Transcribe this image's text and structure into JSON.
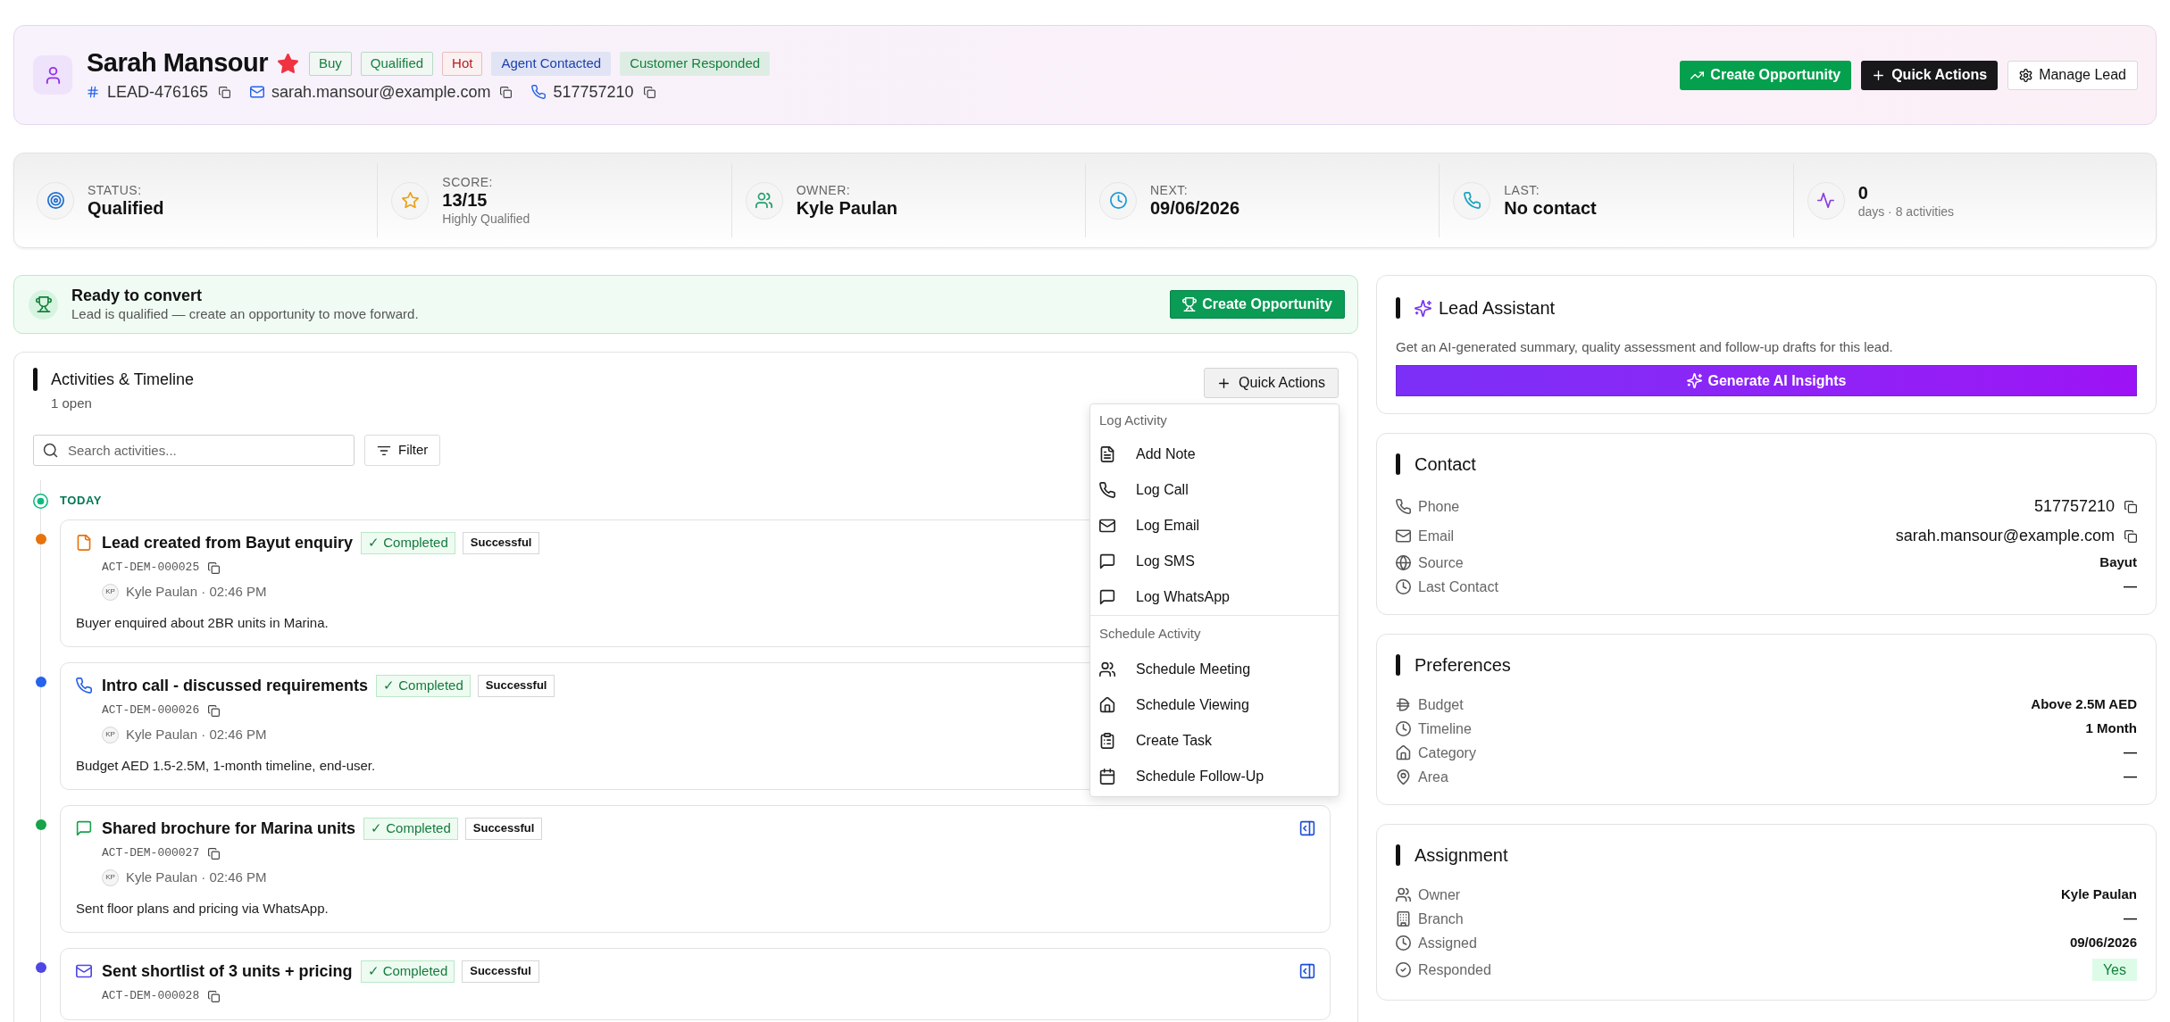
{
  "lead": {
    "name": "Sarah Mansour",
    "starred": true,
    "tags": [
      {
        "label": "Buy",
        "kind": "outline",
        "color": "#15803d"
      },
      {
        "label": "Qualified",
        "kind": "outline",
        "color": "#15803d"
      },
      {
        "label": "Hot",
        "kind": "outline",
        "color": "#b91c1c"
      },
      {
        "label": "Agent Contacted",
        "kind": "filled",
        "color": "#1e40af"
      },
      {
        "label": "Customer Responded",
        "kind": "filled",
        "color": "#15803d"
      }
    ],
    "id": "LEAD-476165",
    "email": "sarah.mansour@example.com",
    "phone": "517757210"
  },
  "header_actions": [
    {
      "label": "Create Opportunity",
      "kind": "create_opportunity"
    },
    {
      "label": "Quick Actions",
      "kind": "quick_actions"
    },
    {
      "label": "Manage Lead",
      "kind": "manage"
    }
  ],
  "stats": [
    {
      "kind": "status",
      "label": "STATUS:",
      "value": "Qualified"
    },
    {
      "kind": "score",
      "label": "SCORE:",
      "value": "13/15",
      "note": "Highly Qualified"
    },
    {
      "kind": "owner",
      "label": "OWNER:",
      "value": "Kyle Paulan"
    },
    {
      "kind": "next",
      "label": "NEXT:",
      "value": "09/06/2026"
    },
    {
      "kind": "last",
      "label": "LAST:",
      "value": "No contact"
    },
    {
      "kind": "activity",
      "value": "0",
      "note": "days · 8 activities"
    }
  ],
  "convert_banner": {
    "title": "Ready to convert",
    "message": "Lead is qualified — create an opportunity to move forward.",
    "button": "Create Opportunity"
  },
  "activities": {
    "title": "Activities & Timeline",
    "subtitle": "1 open",
    "quick_actions": {
      "label": "Quick Actions",
      "expanded": true
    },
    "quick_actions_menu": [
      {
        "heading": "Log Activity",
        "items": [
          {
            "label": "Add Note",
            "kind": "note"
          },
          {
            "label": "Log Call",
            "kind": "call"
          },
          {
            "label": "Log Email",
            "kind": "email"
          },
          {
            "label": "Log SMS",
            "kind": "sms"
          },
          {
            "label": "Log WhatsApp",
            "kind": "whatsapp"
          }
        ]
      },
      {
        "heading": "Schedule Activity",
        "items": [
          {
            "label": "Schedule Meeting",
            "kind": "meeting"
          },
          {
            "label": "Schedule Viewing",
            "kind": "viewing"
          },
          {
            "label": "Create Task",
            "kind": "task"
          },
          {
            "label": "Schedule Follow-Up",
            "kind": "follow_up"
          }
        ]
      }
    ],
    "search": {
      "placeholder": "Search activities..."
    },
    "filter": "Filter",
    "group": "TODAY",
    "items": [
      {
        "kind": "note",
        "color": "#e8720c",
        "title": "Lead created from Bayut enquiry",
        "status": "✓ Completed",
        "outcome": "Successful",
        "ref": "ACT-DEM-000025",
        "initials": "KP",
        "byline": "Kyle Paulan · 02:46 PM",
        "body": "Buyer enquired about 2BR units in Marina."
      },
      {
        "kind": "call",
        "color": "#2563eb",
        "title": "Intro call - discussed requirements",
        "status": "✓ Completed",
        "outcome": "Successful",
        "ref": "ACT-DEM-000026",
        "initials": "KP",
        "byline": "Kyle Paulan · 02:46 PM",
        "body": "Budget AED 1.5-2.5M, 1-month timeline, end-user."
      },
      {
        "kind": "message",
        "color": "#16a34a",
        "title": "Shared brochure for Marina units",
        "status": "✓ Completed",
        "outcome": "Successful",
        "ref": "ACT-DEM-000027",
        "initials": "KP",
        "byline": "Kyle Paulan · 02:46 PM",
        "body": "Sent floor plans and pricing via WhatsApp.",
        "details_button": true
      },
      {
        "kind": "email",
        "color": "#4f46e5",
        "title": "Sent shortlist of 3 units + pricing",
        "status": "✓ Completed",
        "outcome": "Successful",
        "ref": "ACT-DEM-000028",
        "details_button": true
      }
    ]
  },
  "lead_assistant": {
    "title": "Lead Assistant",
    "description": "Get an AI-generated summary, quality assessment and follow-up drafts for this lead.",
    "button": "Generate AI Insights"
  },
  "contact": {
    "title": "Contact",
    "rows": [
      {
        "kind": "phone",
        "label": "Phone",
        "value": "517757210",
        "copyable": true
      },
      {
        "kind": "email",
        "label": "Email",
        "value": "sarah.mansour@example.com",
        "copyable": true
      },
      {
        "kind": "source",
        "label": "Source",
        "value": "Bayut",
        "copyable": false
      },
      {
        "kind": "last_contact",
        "label": "Last Contact",
        "value": "—",
        "copyable": false
      }
    ]
  },
  "preferences": {
    "title": "Preferences",
    "rows": [
      {
        "kind": "budget",
        "label": "Budget",
        "value": "Above 2.5M AED"
      },
      {
        "kind": "timeline",
        "label": "Timeline",
        "value": "1 Month"
      },
      {
        "kind": "category",
        "label": "Category",
        "value": "—"
      },
      {
        "kind": "area",
        "label": "Area",
        "value": "—"
      }
    ]
  },
  "assignment": {
    "title": "Assignment",
    "rows": [
      {
        "kind": "owner",
        "label": "Owner",
        "value": "Kyle Paulan"
      },
      {
        "kind": "branch",
        "label": "Branch",
        "value": "—"
      },
      {
        "kind": "assigned",
        "label": "Assigned",
        "value": "09/06/2026"
      },
      {
        "kind": "responded",
        "label": "Responded",
        "value": "Yes"
      }
    ]
  }
}
